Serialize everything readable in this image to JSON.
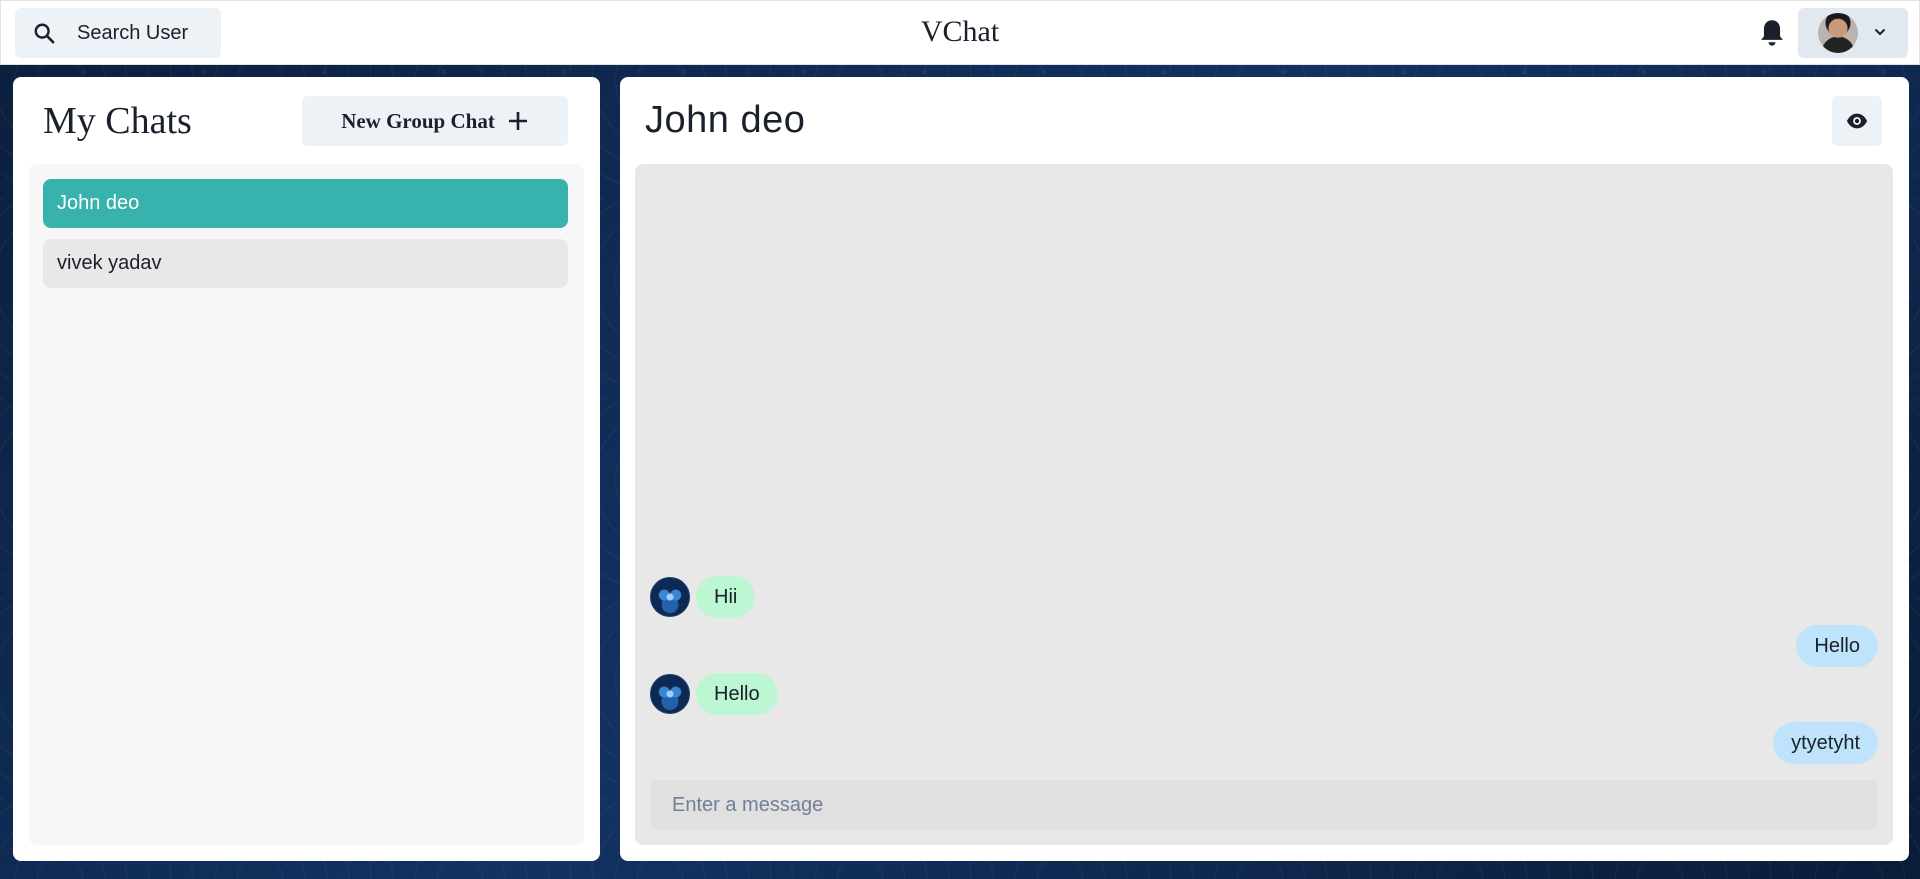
{
  "header": {
    "search_label": "Search User",
    "app_title": "VChat"
  },
  "sidebar": {
    "title": "My Chats",
    "new_group_label": "New Group Chat",
    "chats": [
      {
        "name": "John deo",
        "active": true
      },
      {
        "name": "vivek yadav",
        "active": false
      }
    ]
  },
  "chat": {
    "title": "John deo",
    "messages": [
      {
        "text": "Hii",
        "direction": "incoming"
      },
      {
        "text": "Hello",
        "direction": "outgoing"
      },
      {
        "text": "Hello",
        "direction": "incoming"
      },
      {
        "text": "ytyetyht",
        "direction": "outgoing"
      }
    ],
    "input_placeholder": "Enter a message"
  },
  "colors": {
    "active_chat": "#38b2ac",
    "incoming_bubble": "#bdf6d2",
    "outgoing_bubble": "#bfe3fb"
  },
  "icons": {
    "search": "search-icon",
    "bell": "bell-icon",
    "chevron": "chevron-down-icon",
    "plus": "plus-icon",
    "eye": "eye-icon"
  }
}
